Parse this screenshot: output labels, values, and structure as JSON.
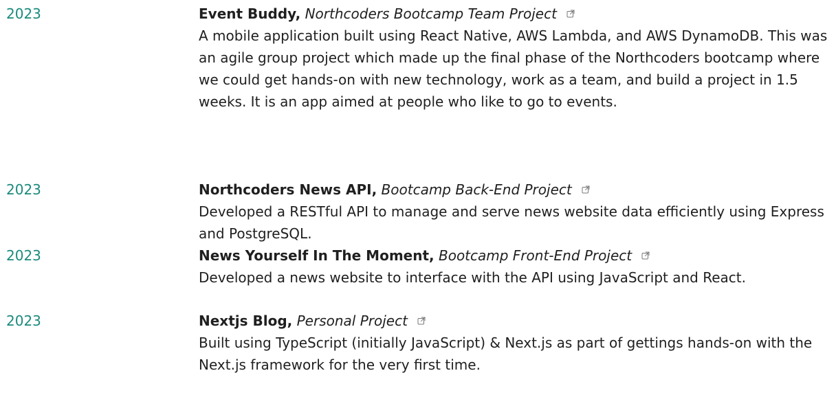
{
  "projects": [
    {
      "year": "2023",
      "title": "Event Buddy,",
      "subtitle": "Northcoders Bootcamp Team Project",
      "description": "A mobile application built using React Native, AWS Lambda, and AWS DynamoDB. This was an agile group project which made up the final phase of the Northcoders bootcamp where we could get hands-on with new technology, work as a team, and build a project in 1.5 weeks. It is an app aimed at people who like to go to events.",
      "link_icon": "external-link-icon"
    },
    {
      "year": "2023",
      "title": "Northcoders News API,",
      "subtitle": "Bootcamp Back-End Project",
      "description": "Developed a RESTful API to manage and serve news website data efficiently using Express and PostgreSQL.",
      "link_icon": "external-link-icon"
    },
    {
      "year": "2023",
      "title": "News Yourself In The Moment,",
      "subtitle": "Bootcamp Front-End Project",
      "description": "Developed a news website to interface with the API using JavaScript and React.",
      "link_icon": "external-link-icon"
    },
    {
      "year": "2023",
      "title": "Nextjs Blog,",
      "subtitle": "Personal Project",
      "description": "Built using TypeScript (initially JavaScript) & Next.js as part of gettings hands-on with the Next.js framework for the very first time.",
      "link_icon": "external-link-icon"
    }
  ],
  "colors": {
    "year": "#1a8a7d",
    "text": "#1f1f1f",
    "link_icon": "#777777"
  }
}
